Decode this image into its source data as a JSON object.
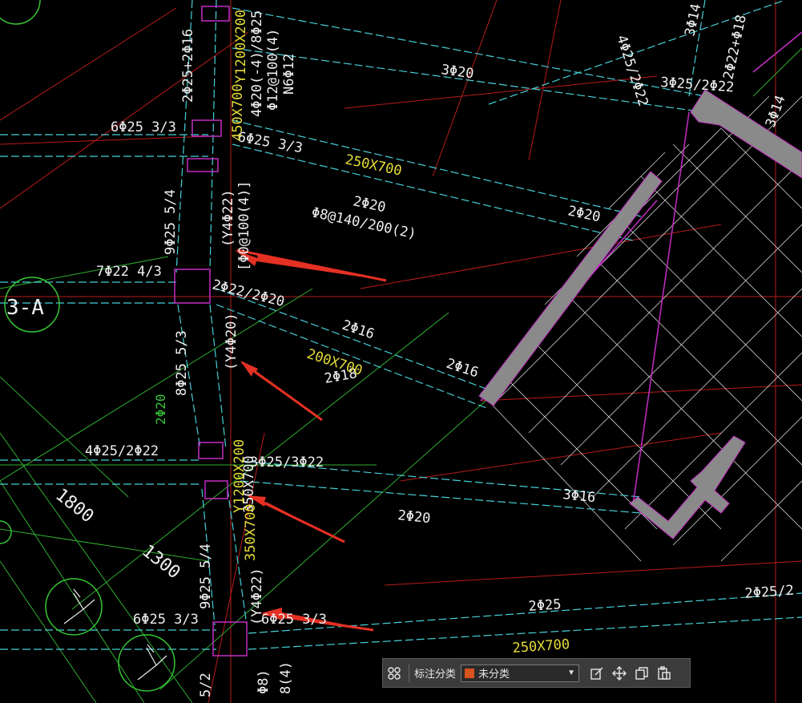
{
  "drawing": {
    "axis_label": "3-A",
    "annotations": {
      "t1": "2Φ25+2Φ16",
      "t2": "450X700",
      "t3": "Y1200X200",
      "t4": "4Φ20(-4)/8Φ25",
      "t5": "Φ12@100(4)",
      "t6": "N6Φ12",
      "t7": "6Φ25 3/3",
      "t8": "6Φ25 3/3",
      "t9": "3Φ20",
      "t10": "250X700",
      "t11": "2Φ20",
      "t12": "Φ8@140/200(2)",
      "t13": "2Φ20",
      "t14": "9Φ25 5/4",
      "t15": "(Y4Φ22)",
      "t16": "[Φ0@100(4)]",
      "t17": "7Φ22 4/3",
      "t18": "2Φ22/2Φ20",
      "t19": "2Φ16",
      "t20": "200X700",
      "t21": "2Φ18",
      "t22": "2Φ16",
      "t23": "8Φ25 5/3",
      "t24": "(Y4Φ20)",
      "t25": "2Φ20",
      "t26": "4Φ25/2Φ22",
      "t27": "3Φ25/3Φ22",
      "t28": "Y1200X200",
      "t29": "350X700",
      "t30": "3Φ16",
      "t31": "2Φ20",
      "t32": "1800",
      "t33": "1300",
      "t34": "9Φ25 5/4",
      "t35": "6Φ25 3/3",
      "t36": "(Y4Φ22)",
      "t37": "6Φ25 3/3",
      "t38": "2Φ25",
      "t39": "250X700",
      "t40": "2Φ25/2",
      "t41": "4Φ25/2Φ22",
      "t42": "3Φ14",
      "t43": "2Φ22+Φ18",
      "t44": "3Φ14",
      "t45": "3Φ25/2Φ22",
      "t46": "5/2",
      "t47": "8(4)",
      "t48": "Φ8)"
    }
  },
  "toolbar": {
    "category_label": "标注分类",
    "category_value": "未分类",
    "category_color": "#d9531e"
  },
  "colors": {
    "background": "#000000",
    "cyan": "#4fd6dd",
    "white_text": "#f0f0f0",
    "yellow_text": "#e8e040",
    "green_line": "#39c43a",
    "red_line": "#c8201d",
    "magenta": "#c62fc6",
    "gray_wall": "#8c8c8c",
    "arrow_red": "#e83025"
  }
}
